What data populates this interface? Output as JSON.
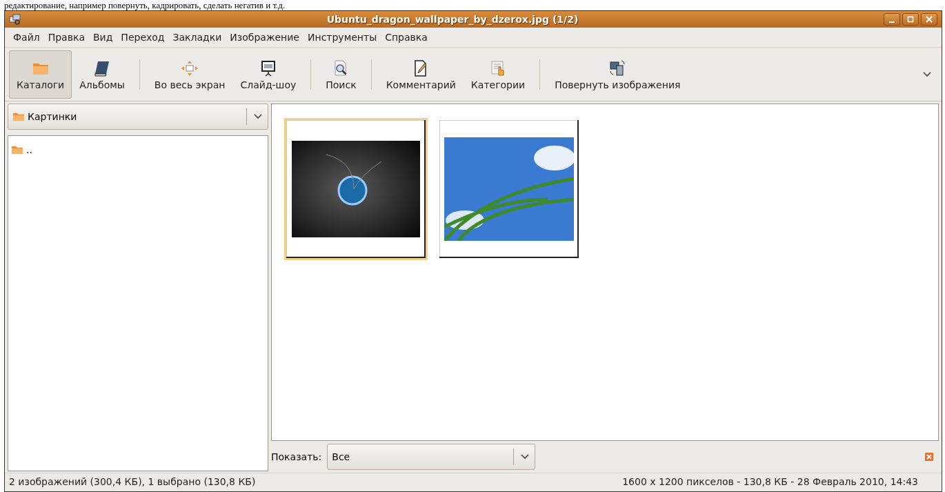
{
  "caption": "редактирование, например повернуть, кадрировать, сделать негатив и т.д.",
  "window": {
    "title": "Ubuntu_dragon_wallpaper_by_dzerox.jpg  (1/2)"
  },
  "menu": [
    "Файл",
    "Правка",
    "Вид",
    "Переход",
    "Закладки",
    "Изображение",
    "Инструменты",
    "Справка"
  ],
  "toolbar": [
    {
      "label": "Каталоги",
      "selected": true
    },
    {
      "label": "Альбомы",
      "selected": false
    },
    {
      "label": "Во весь экран",
      "selected": false
    },
    {
      "label": "Слайд-шоу",
      "selected": false
    },
    {
      "label": "Поиск",
      "selected": false
    },
    {
      "label": "Комментарий",
      "selected": false
    },
    {
      "label": "Категории",
      "selected": false
    },
    {
      "label": "Повернуть изображения",
      "selected": false
    }
  ],
  "location": {
    "value": "Картинки"
  },
  "folders": [
    {
      "name": ".."
    }
  ],
  "thumbnails": [
    {
      "kind": "dark",
      "selected": true
    },
    {
      "kind": "sky",
      "selected": false
    }
  ],
  "filter": {
    "label": "Показать:",
    "value": "Все"
  },
  "status": {
    "left": "2 изображений (300,4 КБ), 1 выбрано (130,8 КБ)",
    "right": "1600 x 1200 пикселов - 130,8 КБ - 28 Февраль 2010, 14:43"
  }
}
